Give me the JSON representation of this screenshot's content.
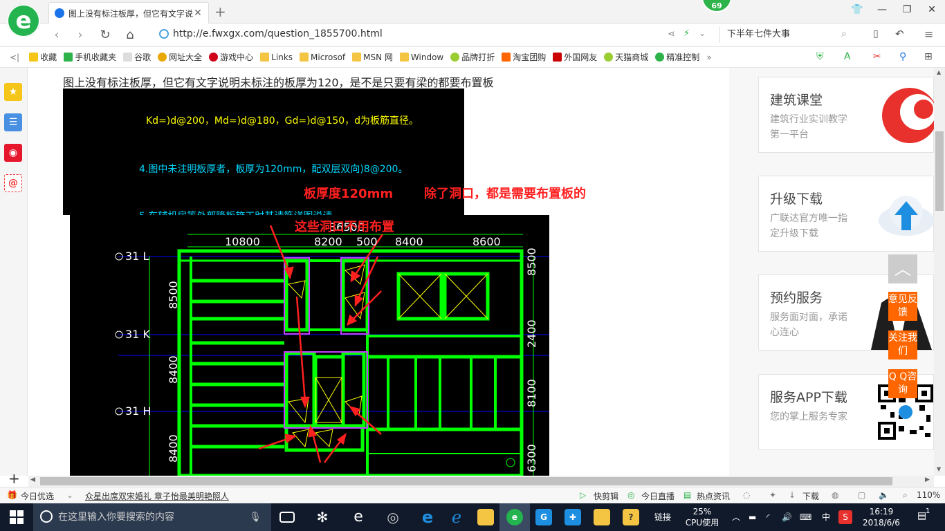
{
  "browser": {
    "tab_title": "图上没有标注板厚，但它有文字说明未标注",
    "badge": "69",
    "url": "http://e.fwxgx.com/question_1855700.html",
    "search_text": "下半年七件大事"
  },
  "bookmarks": [
    "收藏",
    "手机收藏夹",
    "谷歌",
    "网址大全",
    "游戏中心",
    "Links",
    "Microsof",
    "MSN 网",
    "Window",
    "品牌打折",
    "淘宝团购",
    "外国网友",
    "天猫商城",
    "精准控制"
  ],
  "question": {
    "title": "图上没有标注板厚，但它有文字说明未标注的板厚为120，是不是只要有梁的都要布置板"
  },
  "cad_top": {
    "line1": "Kd=)d@200，Md=)d@180，Gd=)d@150，d为板筋直径。",
    "line2": "4.图中未注明板厚者，板厚为120mm，配双层双向)8@200。",
    "line3": "5.车辅机房等处部降板施工时其请筋详图说请。"
  },
  "annotations": {
    "thickness": "板厚度120mm",
    "except": "除了洞口，都是需要布置板的",
    "holes": "这些洞口不用布置"
  },
  "dims": {
    "top_total": "36500",
    "top_1": "10800",
    "top_2": "8200",
    "top_3": "500",
    "top_4": "8400",
    "top_5": "8600",
    "right_1": "8500",
    "right_2": "2400",
    "right_3": "8100",
    "right_4": "6300",
    "left_1": "8500",
    "left_2": "8400",
    "left_3": "8400",
    "axis_l": "31 L",
    "axis_k": "31 K",
    "axis_h": "31 H"
  },
  "right_cards": [
    {
      "title": "建筑课堂",
      "sub": "建筑行业实训教学第一平台"
    },
    {
      "title": "升级下载",
      "sub": "广联达官方唯一指定升级下载"
    },
    {
      "title": "预约服务",
      "sub": "服务面对面，承诺心连心"
    },
    {
      "title": "服务APP下载",
      "sub": "您的掌上服务专家"
    }
  ],
  "float_buttons": [
    "意见反馈",
    "关注我们",
    "Q Q咨询"
  ],
  "statusbar": {
    "today": "今日优选",
    "news": "众星出席双宋婚礼 章子怡最美明艳照人",
    "quick_cut": "快剪辑",
    "live": "今日直播",
    "hot": "热点资讯",
    "download": "下载",
    "zoom": "110%"
  },
  "taskbar": {
    "search_placeholder": "在这里输入你要搜索的内容",
    "link": "链接",
    "cpu": "25%",
    "cpu_label": "CPU使用",
    "ime": "中",
    "time": "16:19",
    "date": "2018/6/6",
    "notifications": "1"
  },
  "colors": {
    "accent_green": "#24b44f",
    "orange": "#ff6600",
    "cad_green": "#00ff00",
    "cad_red": "#ff2020",
    "cad_yellow": "#ffff00",
    "cad_cyan": "#00d8ff"
  }
}
